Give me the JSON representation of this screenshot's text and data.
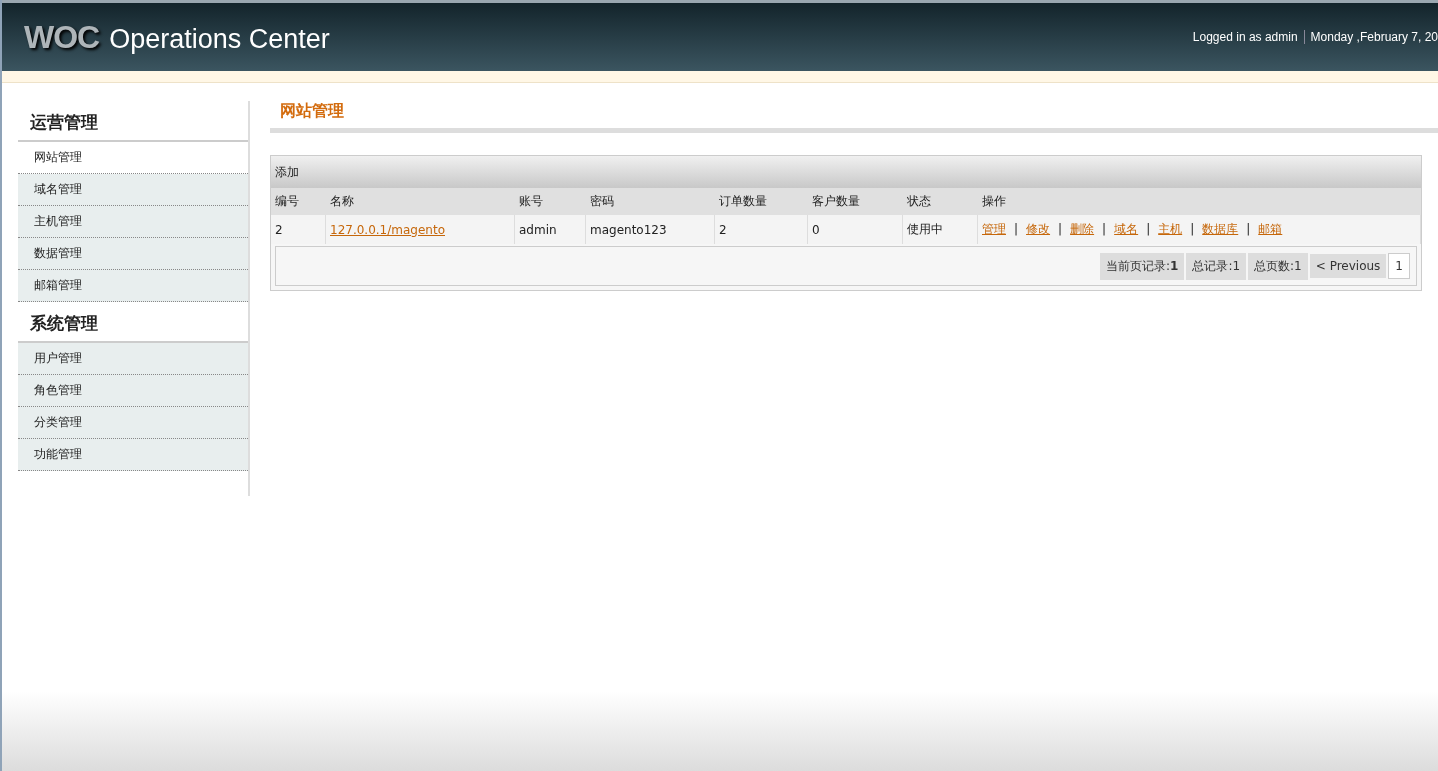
{
  "header": {
    "logo": "WOC",
    "title": "Operations Center",
    "user": "Logged in as admin",
    "date": "Monday ,February 7, 20"
  },
  "sidebar": {
    "groups": [
      {
        "title": "运营管理",
        "items": [
          {
            "label": "网站管理",
            "selected": true
          },
          {
            "label": "域名管理",
            "selected": false
          },
          {
            "label": "主机管理",
            "selected": false
          },
          {
            "label": "数据管理",
            "selected": false
          },
          {
            "label": "邮箱管理",
            "selected": false
          }
        ]
      },
      {
        "title": "系统管理",
        "items": [
          {
            "label": "用户管理",
            "selected": false
          },
          {
            "label": "角色管理",
            "selected": false
          },
          {
            "label": "分类管理",
            "selected": false
          },
          {
            "label": "功能管理",
            "selected": false
          }
        ]
      }
    ]
  },
  "page_title": "网站管理",
  "toolbar": {
    "add": "添加"
  },
  "table": {
    "columns": [
      "编号",
      "名称",
      "账号",
      "密码",
      "订单数量",
      "客户数量",
      "状态",
      "操作"
    ],
    "rows": [
      {
        "id": "2",
        "name": "127.0.0.1/magento",
        "account": "admin",
        "password": "magento123",
        "orders": "2",
        "customers": "0",
        "status": "使用中",
        "actions": [
          {
            "label": "管理",
            "separator": "|"
          },
          {
            "label": "修改",
            "separator": "|"
          },
          {
            "label": "删除",
            "separator": "|"
          },
          {
            "label": "域名",
            "separator": "|"
          },
          {
            "label": "主机",
            "separator": "|"
          },
          {
            "label": "数据库",
            "separator": "|"
          },
          {
            "label": "邮箱"
          }
        ]
      }
    ]
  },
  "pagination": {
    "current_label": "当前页记录:",
    "current_value": "1",
    "total": "总记录:1",
    "pages": "总页数:1",
    "previous": "< Previous",
    "page": "1"
  }
}
